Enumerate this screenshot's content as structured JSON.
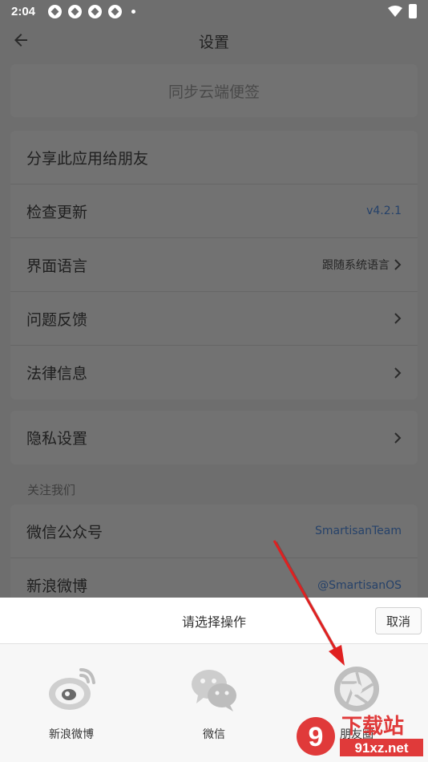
{
  "status_bar": {
    "time": "2:04"
  },
  "header": {
    "title": "设置"
  },
  "sync": {
    "label": "同步云端便签"
  },
  "settings": {
    "share": "分享此应用给朋友",
    "update": {
      "label": "检查更新",
      "value": "v4.2.1"
    },
    "language": {
      "label": "界面语言",
      "value": "跟随系统语言"
    },
    "feedback": "问题反馈",
    "legal": "法律信息"
  },
  "privacy": {
    "label": "隐私设置"
  },
  "follow": {
    "section_title": "关注我们",
    "wechat": {
      "label": "微信公众号",
      "value": "SmartisanTeam"
    },
    "weibo": {
      "label": "新浪微博",
      "value": "@SmartisanOS"
    }
  },
  "share_sheet": {
    "title": "请选择操作",
    "cancel": "取消",
    "targets": [
      {
        "label": "新浪微博",
        "icon": "weibo-icon"
      },
      {
        "label": "微信",
        "icon": "wechat-icon"
      },
      {
        "label": "朋友圈",
        "icon": "moments-icon"
      }
    ]
  },
  "watermark": {
    "text": "下载站",
    "domain": "91xz.net",
    "logo": "9"
  },
  "colors": {
    "dim": "#6e6e6e",
    "accent_blue": "#26426a",
    "arrow": "#e02020"
  }
}
